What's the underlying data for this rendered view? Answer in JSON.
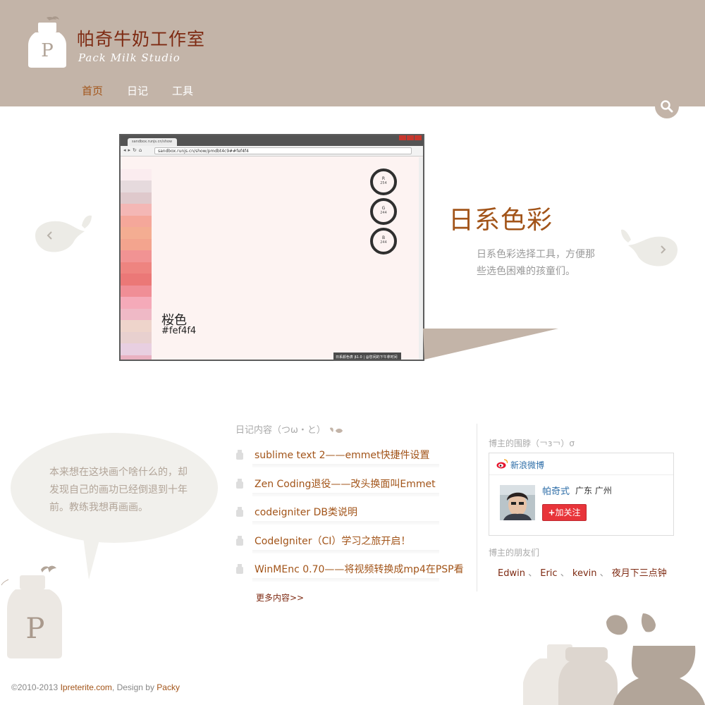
{
  "header": {
    "title": "帕奇牛奶工作室",
    "subtitle": "Pack Milk Studio",
    "logo_letter": "P",
    "nav": [
      {
        "label": "首页",
        "active": true
      },
      {
        "label": "日记",
        "active": false
      },
      {
        "label": "工具",
        "active": false
      }
    ],
    "search_icon": "search-icon"
  },
  "slider": {
    "title": "日系色彩",
    "description": "日系色彩选择工具，方便那些选色困难的孩童们。",
    "screenshot": {
      "tab_text": "sandbox.runjs.cn/show",
      "url": "sandbox.runjs.cn/show/pmdbt4c9##fef4f4",
      "swatches": [
        "#fdf3f2",
        "#fbecef",
        "#e6dadd",
        "#dfc9cc",
        "#f4b7b5",
        "#f5a79a",
        "#f4ad92",
        "#f3a48e",
        "#f19393",
        "#ee8480",
        "#eb7877",
        "#f08e96",
        "#f5aab9",
        "#efb9c6",
        "#eed4cb",
        "#e8d0cf",
        "#e8cfe1",
        "#e9b1c1"
      ],
      "rings": [
        {
          "label": "R",
          "value": "254"
        },
        {
          "label": "G",
          "value": "244"
        },
        {
          "label": "B",
          "value": "244"
        }
      ],
      "color_name": "桜色",
      "color_hex": "#fef4f4",
      "status": "日系颜色表 β1.0 | @您闲的下午拿时间"
    },
    "prev_icon": "chevron-left-icon",
    "next_icon": "chevron-right-icon"
  },
  "intro": {
    "text": "本来想在这块画个啥什么的，却发现自己的画功已经倒退到十年前。教练我想再画画。"
  },
  "diary": {
    "title": "日记内容（つω・と）",
    "items": [
      "sublime text 2——emmet快捷件设置",
      "Zen Coding退役——改头换面叫Emmet",
      "codeigniter DB类说明",
      "CodeIgniter（CI）学习之旅开启！",
      "WinMEnc 0.70——将视频转换成mp4在PSP看"
    ],
    "more": "更多内容>>"
  },
  "sidebar": {
    "weibo_title": "博主的围脖（￢з￢）σ",
    "weibo_label": "新浪微博",
    "weibo_name": "帕奇式",
    "weibo_location": "广东 广州",
    "follow": "加关注",
    "friends_title": "博主的朋友们",
    "friends": [
      "Edwin",
      "Eric",
      "kevin",
      "夜月下三点钟"
    ],
    "friends_sep": "、"
  },
  "footer": {
    "copyright": "©2010-2013 ",
    "site": "Ipreterite.com",
    "design_by": ", Design by ",
    "author": "Packy"
  },
  "colors": {
    "header_bg": "#c3b4a8",
    "accent": "#a25419",
    "title": "#7e2a12",
    "link_blue": "#2e6ea8",
    "follow_red": "#e8343a"
  }
}
